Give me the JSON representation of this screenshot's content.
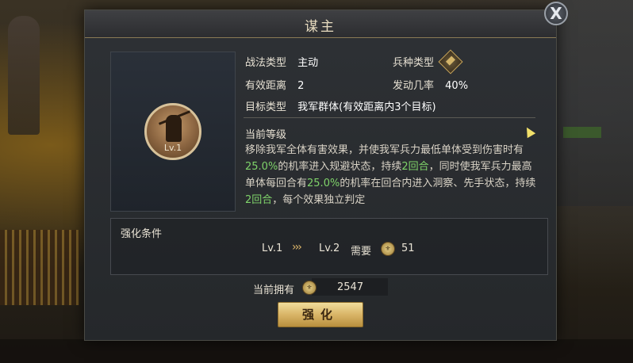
{
  "dialog": {
    "title": "谋主",
    "close_label": "X"
  },
  "skill": {
    "level_badge": "Lv.1",
    "type_label": "战法类型",
    "type_value": "主动",
    "troop_label": "兵种类型",
    "troop_icon": "cavalry-icon",
    "range_label": "有效距离",
    "range_value": "2",
    "rate_label": "发动几率",
    "rate_value": "40%",
    "target_label": "目标类型",
    "target_value": "我军群体(有效距离内3个目标)"
  },
  "current_level": {
    "title": "当前等级",
    "desc": [
      {
        "t": "移除我军全体有害效果，并使我军兵力最低单体受到伤害时",
        "hl": false
      },
      {
        "t": "有",
        "hl": false
      },
      {
        "t": "25.0%",
        "hl": true
      },
      {
        "t": "的机率进入规避状态，持续",
        "hl": false
      },
      {
        "t": "2回合",
        "hl": true
      },
      {
        "t": "，同时使我军兵",
        "hl": false
      },
      {
        "t": "力最高单体每回合有",
        "hl": false
      },
      {
        "t": "25.0%",
        "hl": true
      },
      {
        "t": "的机率在回合内进入洞察、先手",
        "hl": false
      },
      {
        "t": "状态，持续",
        "hl": false
      },
      {
        "t": "2回合",
        "hl": true
      },
      {
        "t": "，每个效果独立判定",
        "hl": false
      }
    ]
  },
  "enhance": {
    "title": "强化条件",
    "from_level": "Lv.1",
    "arrows": "›››",
    "to_level": "Lv.2",
    "need_label": "需要",
    "need_value": "51",
    "coin_icon": "tactic-point-icon",
    "owned_label": "当前拥有",
    "owned_value": "2547",
    "button_label": "强化"
  },
  "colors": {
    "highlight": "#7fd36a",
    "button_gold": "#d9b567",
    "title_text": "#e8dcc0"
  }
}
